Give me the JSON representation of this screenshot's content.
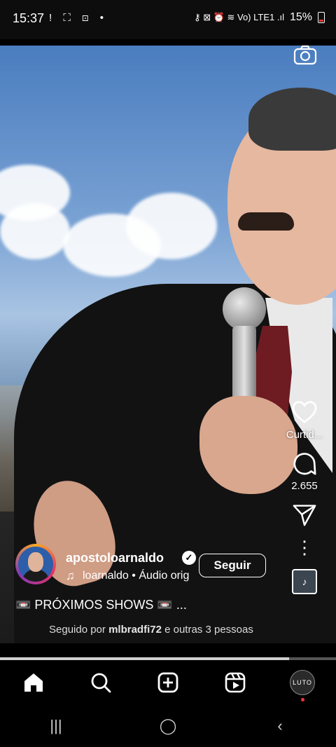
{
  "status_bar": {
    "time": "15:37",
    "left_icons": "! ⛶ ⊡ •",
    "right_icons": "⚷ ⊠ ⏰ ≋ Vo) LTE1 .ıl",
    "battery": "15%"
  },
  "reel": {
    "author": {
      "username": "apostoloarnaldo",
      "verified": true,
      "follow_label": "Seguir"
    },
    "audio": "loarnaldo • Áudio orig",
    "caption": "📼 PRÓXIMOS SHOWS 📼 ...",
    "followed_by": {
      "prefix": "Seguido por",
      "user": "mlbradfi72",
      "suffix": "e outras 3 pessoas"
    },
    "actions": {
      "like_label": "Curtid...",
      "comment_count": "2.655"
    },
    "progress": 0.86
  },
  "bottom_nav": {
    "items": [
      "home-icon",
      "search-icon",
      "create-icon",
      "reels-icon",
      "profile"
    ],
    "profile_text": "LUTO"
  },
  "system_nav": {
    "recents": "|||",
    "home": "◯",
    "back": "‹"
  },
  "colors": {
    "accent_red": "#ff3040",
    "background": "#000000"
  }
}
